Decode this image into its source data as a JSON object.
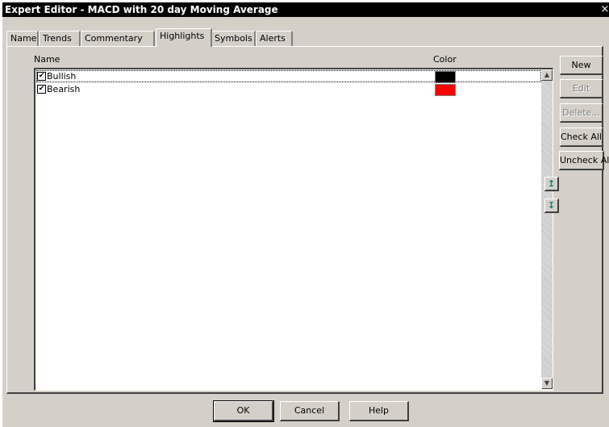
{
  "window": {
    "title": "Expert Editor - MACD with 20 day Moving Average",
    "close": "×"
  },
  "tabs": [
    {
      "label": "Name"
    },
    {
      "label": "Trends"
    },
    {
      "label": "Commentary"
    },
    {
      "label": "Highlights"
    },
    {
      "label": "Symbols"
    },
    {
      "label": "Alerts"
    }
  ],
  "active_tab": "Highlights",
  "list": {
    "headers": {
      "name": "Name",
      "color": "Color"
    },
    "rows": [
      {
        "name": "Bullish",
        "checked": true,
        "color": "#000000"
      },
      {
        "name": "Bearish",
        "checked": true,
        "color": "#ff0000"
      }
    ]
  },
  "side_buttons": {
    "new": "New",
    "edit": "Edit",
    "delete": "Delete...",
    "check_all": "Check All",
    "uncheck_all": "Uncheck All"
  },
  "move_buttons": {
    "up": "↥",
    "down": "↧"
  },
  "dialog_buttons": {
    "ok": "OK",
    "cancel": "Cancel",
    "help": "Help"
  },
  "check_mark": "✔"
}
